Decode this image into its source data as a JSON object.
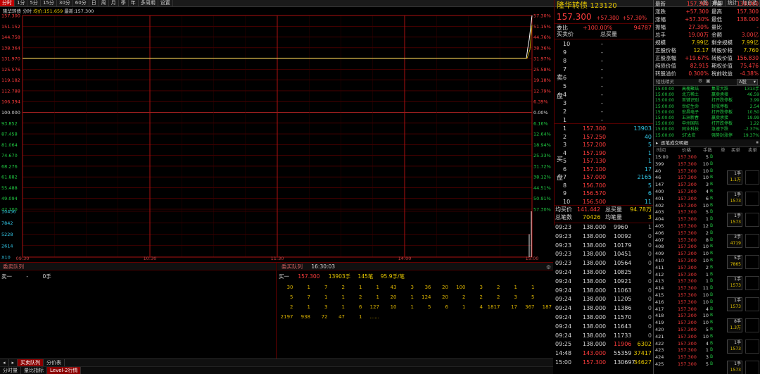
{
  "toolbar": {
    "items": [
      "分时",
      "1分",
      "5分",
      "15分",
      "30分",
      "60分",
      "日",
      "周",
      "月",
      "季",
      "年",
      "多周期",
      "设置"
    ],
    "right": [
      "A股",
      "叠加",
      "统计",
      "加自选"
    ]
  },
  "chart": {
    "legend": {
      "name": "隆华转债",
      "label_avg": "分时",
      "avg_label": "均价:",
      "avg": "151.659",
      "last_label": "最新:",
      "last": "157.300"
    },
    "ylabels_left": [
      "157.300",
      "151.152",
      "144.758",
      "138.364",
      "131.970",
      "125.576",
      "119.182",
      "112.788",
      "106.394",
      "100.000",
      "93.852",
      "87.458",
      "81.064",
      "74.670",
      "68.276",
      "61.882",
      "55.488",
      "49.094",
      "42.700",
      "10456",
      "7842",
      "5228",
      "2614",
      "X10"
    ],
    "ylabels_right": [
      "57.30%",
      "51.15%",
      "44.76%",
      "38.36%",
      "31.97%",
      "25.58%",
      "19.18%",
      "12.79%",
      "6.39%",
      "0.00%",
      "6.16%",
      "12.64%",
      "18.94%",
      "25.33%",
      "31.72%",
      "38.12%",
      "44.51%",
      "50.91%",
      "57.30%"
    ],
    "xlabels": [
      "09:30",
      "10:30",
      "11:30",
      "14:00",
      "15:00"
    ],
    "price_series": {
      "times": [
        "09:30",
        "09:25 open",
        "14:55",
        "14:57",
        "14:58",
        "14:59",
        "15:00"
      ],
      "values": [
        131.97,
        131.97,
        131.97,
        138.0,
        143.0,
        150.0,
        157.3
      ]
    },
    "volume_bars": [
      {
        "time": "14:58",
        "value": "5228"
      },
      {
        "time": "15:00",
        "value": "10456"
      }
    ]
  },
  "left_queue": {
    "title": "委卖队列",
    "row": {
      "label": "卖一",
      "dash": "-",
      "qty": "0手"
    }
  },
  "right_queue": {
    "title": "委买队列",
    "time": "16:30:03",
    "row": {
      "label": "买一",
      "price": "157.300",
      "qty": "13903手",
      "cnt": "145笔",
      "avg": "95.9手/笔"
    },
    "rows": [
      [
        "30",
        "1",
        "7",
        "2",
        "1",
        "1",
        "43",
        "3",
        "36",
        "20",
        "100",
        "3",
        "2",
        "1",
        "1"
      ],
      [
        "5",
        "7",
        "1",
        "1",
        "2",
        "1",
        "20",
        "1",
        "124",
        "20",
        "2",
        "2",
        "2",
        "3",
        "5"
      ],
      [
        "2",
        "1",
        "3",
        "1",
        "6",
        "127",
        "10",
        "1",
        "5",
        "6",
        "1",
        "4",
        "1817",
        "17",
        "367",
        "187"
      ],
      [
        "2197",
        "938",
        "72",
        "47",
        "1",
        "......"
      ]
    ]
  },
  "bottom_tabs": [
    "买卖队列",
    "分价表"
  ],
  "bottom_tabs2": [
    "分时量",
    "量比指标",
    "Level-2行情"
  ],
  "quote": {
    "name": "隆华转债",
    "code": "123120",
    "price": "157.300",
    "change": "+57.300",
    "pct": "+57.30%",
    "wb_label": "委比",
    "wb": "+100.00%",
    "wc": "94787",
    "mm_label": "买卖价",
    "mm_vol": "总买量",
    "sells": [
      {
        "lvl": "10",
        "p": "-",
        "v": ""
      },
      {
        "lvl": "9",
        "p": "-",
        "v": ""
      },
      {
        "lvl": "8",
        "p": "-",
        "v": ""
      },
      {
        "lvl": "7",
        "p": "-",
        "v": ""
      },
      {
        "lvl": "6",
        "p": "-",
        "v": ""
      },
      {
        "lvl": "5",
        "p": "-",
        "v": ""
      },
      {
        "lvl": "4",
        "p": "-",
        "v": ""
      },
      {
        "lvl": "3",
        "p": "-",
        "v": ""
      },
      {
        "lvl": "2",
        "p": "-",
        "v": ""
      },
      {
        "lvl": "1",
        "p": "-",
        "v": ""
      }
    ],
    "sell_side_label": "卖盘",
    "buy_side_label": "买盘",
    "buys": [
      {
        "lvl": "1",
        "p": "157.300",
        "v": "13903"
      },
      {
        "lvl": "2",
        "p": "157.250",
        "v": "40"
      },
      {
        "lvl": "3",
        "p": "157.200",
        "v": "5"
      },
      {
        "lvl": "4",
        "p": "157.190",
        "v": "1"
      },
      {
        "lvl": "5",
        "p": "157.130",
        "v": "1"
      },
      {
        "lvl": "6",
        "p": "157.100",
        "v": "17"
      },
      {
        "lvl": "7",
        "p": "157.000",
        "v": "2165"
      },
      {
        "lvl": "8",
        "p": "156.700",
        "v": "5"
      },
      {
        "lvl": "9",
        "p": "156.570",
        "v": "6"
      },
      {
        "lvl": "10",
        "p": "156.500",
        "v": "11"
      }
    ],
    "avg_buy_label": "均买价",
    "avg_buy": "141.442",
    "total_buy_label": "总买量",
    "total_buy": "94.78万",
    "total_trades_label": "总笔数",
    "total_trades": "70426",
    "avg_trade_label": "均笔量",
    "avg_trade": "3",
    "trades": [
      [
        "09:23",
        "138.000",
        "9960",
        "1"
      ],
      [
        "09:23",
        "138.000",
        "10092",
        "0"
      ],
      [
        "09:23",
        "138.000",
        "10179",
        "0"
      ],
      [
        "09:23",
        "138.000",
        "10451",
        "0"
      ],
      [
        "09:23",
        "138.000",
        "10564",
        "0"
      ],
      [
        "09:24",
        "138.000",
        "10825",
        "0"
      ],
      [
        "09:24",
        "138.000",
        "10921",
        "0"
      ],
      [
        "09:24",
        "138.000",
        "11063",
        "0"
      ],
      [
        "09:24",
        "138.000",
        "11205",
        "0"
      ],
      [
        "09:24",
        "138.000",
        "11386",
        "0"
      ],
      [
        "09:24",
        "138.000",
        "11570",
        "0"
      ],
      [
        "09:24",
        "138.000",
        "11643",
        "0"
      ],
      [
        "09:24",
        "138.000",
        "11733",
        "0"
      ],
      [
        "09:25",
        "138.000",
        "11906",
        "6302"
      ],
      [
        "14:48",
        "143.000",
        "55359",
        "37417"
      ],
      [
        "15:00",
        "157.300",
        "130697",
        "34627"
      ]
    ]
  },
  "info": {
    "rows": [
      [
        "最新",
        "157.300",
        "开盘",
        "138.000"
      ],
      [
        "涨跌",
        "+57.300",
        "最高",
        "157.300"
      ],
      [
        "涨幅",
        "+57.30%",
        "最低",
        "138.000"
      ],
      [
        "振幅",
        "27.30%",
        "量比",
        "-"
      ],
      [
        "总手",
        "19.00万",
        "金额",
        "3.00亿"
      ],
      [
        "规模",
        "7.99亿",
        "剩余规模",
        "7.99亿"
      ],
      [
        "正股价格",
        "12.17",
        "转股价格",
        "7.760"
      ],
      [
        "正股涨幅",
        "+19.67%",
        "转股价值",
        "156.830"
      ],
      [
        "纯债价值",
        "82.915",
        "期权价值",
        "75.476"
      ],
      [
        "转股溢价",
        "0.300%",
        "税前收益",
        "-4.38%"
      ]
    ]
  },
  "news": {
    "title": "短线精灵",
    "tab": "A股",
    "rows": [
      [
        "15:00:00",
        "高槐聚结",
        "集零大跌",
        "1313手"
      ],
      [
        "15:00:00",
        "北方稀土",
        "赢卖承接",
        "46.59"
      ],
      [
        "15:00:00",
        "首键识别",
        "打开跌停板",
        "3.99"
      ],
      [
        "15:00:00",
        "世纪生命",
        "封涨停板",
        "2.54"
      ],
      [
        "15:00:00",
        "宏昌电子",
        "打开跌停板",
        "10.50"
      ],
      [
        "15:00:00",
        "五洲新春",
        "赢卖承接",
        "19.99"
      ],
      [
        "15:00:00",
        "中州国际",
        "打开跌停板",
        "1.22"
      ],
      [
        "15:00:00",
        "同业科技",
        "急速下跌",
        "-2.37%"
      ],
      [
        "15:00:00",
        "ST太安",
        "强势封涨停",
        "19.37%"
      ]
    ]
  },
  "ticks": {
    "title": "逐笔成交明细",
    "cols": [
      "时间",
      "价格",
      "手数",
      "单",
      "买单",
      "卖单"
    ],
    "rows": [
      [
        "15:00",
        "157.300",
        "5",
        "B"
      ],
      [
        "399",
        "157.300",
        "10",
        "B"
      ],
      [
        "40",
        "157.300",
        "10",
        "B"
      ],
      [
        "46",
        "157.300",
        "10",
        "B"
      ],
      [
        "147",
        "157.300",
        "3",
        "B"
      ],
      [
        "400",
        "157.300",
        "4",
        "B"
      ],
      [
        "401",
        "157.300",
        "6",
        "B"
      ],
      [
        "402",
        "157.300",
        "10",
        "B"
      ],
      [
        "403",
        "157.300",
        "5",
        "B"
      ],
      [
        "404",
        "157.300",
        "1",
        "B"
      ],
      [
        "405",
        "157.300",
        "12",
        "B"
      ],
      [
        "406",
        "157.300",
        "2",
        "B"
      ],
      [
        "407",
        "157.300",
        "8",
        "B"
      ],
      [
        "408",
        "157.300",
        "10",
        "B"
      ],
      [
        "409",
        "157.300",
        "10",
        "B"
      ],
      [
        "410",
        "157.300",
        "10",
        "B"
      ],
      [
        "411",
        "157.300",
        "2",
        "B"
      ],
      [
        "412",
        "157.300",
        "1",
        "B"
      ],
      [
        "413",
        "157.300",
        "1",
        "B"
      ],
      [
        "414",
        "157.300",
        "11",
        "B"
      ],
      [
        "415",
        "157.300",
        "10",
        "B"
      ],
      [
        "416",
        "157.300",
        "10",
        "B"
      ],
      [
        "417",
        "157.300",
        "4",
        "B"
      ],
      [
        "418",
        "157.300",
        "10",
        "B"
      ],
      [
        "419",
        "157.300",
        "10",
        "B"
      ],
      [
        "420",
        "157.300",
        "5",
        "B"
      ],
      [
        "421",
        "157.300",
        "10",
        "B"
      ],
      [
        "422",
        "157.300",
        "4",
        "B"
      ],
      [
        "423",
        "157.300",
        "1",
        "B"
      ],
      [
        "424",
        "157.300",
        "3",
        "B"
      ],
      [
        "425",
        "157.300",
        "5",
        "B"
      ]
    ],
    "buy_blocks": [
      [
        "1手",
        "1.1万"
      ],
      [
        "1手",
        "1573"
      ],
      [
        "1手",
        "1573"
      ],
      [
        "3手",
        "4719"
      ],
      [
        "5手",
        "7865"
      ],
      [
        "1手",
        "1573"
      ],
      [
        "1手",
        "1573"
      ],
      [
        "8手",
        "1.3万"
      ],
      [
        "1手",
        "1573"
      ],
      [
        "1手",
        "1573"
      ]
    ]
  },
  "colors": {
    "up": "#ff3c3c",
    "down": "#22cc44",
    "yellow": "#e8c800",
    "cyan": "#33c8e8",
    "grid": "#6a0000",
    "bg": "#000000"
  }
}
